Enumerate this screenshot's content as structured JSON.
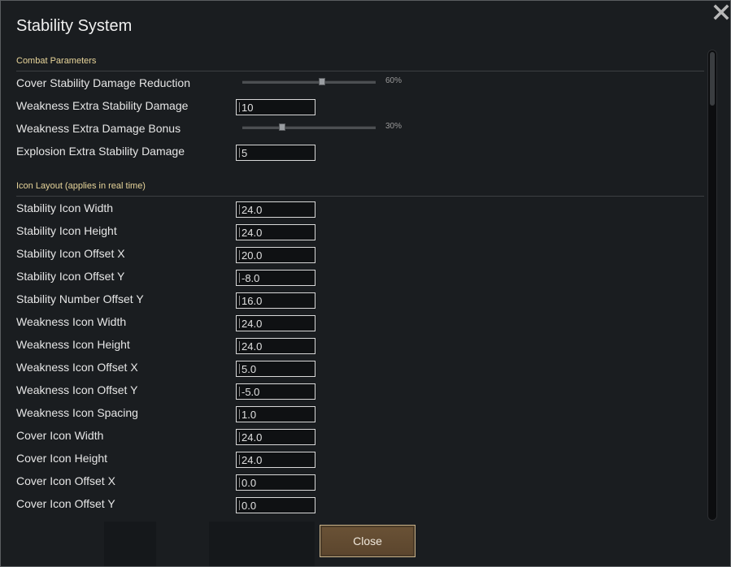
{
  "dialog": {
    "title": "Stability System",
    "close_icon": "close-x-icon"
  },
  "combat": {
    "header": "Combat Parameters",
    "cover_reduction": {
      "label": "Cover Stability Damage Reduction",
      "value_text": "60%",
      "value": 0.6
    },
    "weakness_stability": {
      "label": "Weakness Extra Stability Damage",
      "value": "10"
    },
    "weakness_bonus": {
      "label": "Weakness Extra Damage Bonus",
      "value_text": "30%",
      "value": 0.3
    },
    "explosion_stability": {
      "label": "Explosion Extra Stability Damage",
      "value": "5"
    }
  },
  "icon_layout": {
    "header": "Icon Layout (applies in real time)",
    "fields": [
      {
        "label": "Stability Icon Width",
        "value": "24.0"
      },
      {
        "label": "Stability Icon Height",
        "value": "24.0"
      },
      {
        "label": "Stability Icon Offset X",
        "value": "20.0"
      },
      {
        "label": "Stability Icon Offset Y",
        "value": "-8.0"
      },
      {
        "label": "Stability Number Offset Y",
        "value": "16.0"
      },
      {
        "label": "Weakness Icon Width",
        "value": "24.0"
      },
      {
        "label": "Weakness Icon Height",
        "value": "24.0"
      },
      {
        "label": "Weakness Icon Offset X",
        "value": "5.0"
      },
      {
        "label": "Weakness Icon Offset Y",
        "value": "-5.0"
      },
      {
        "label": "Weakness Icon Spacing",
        "value": "1.0"
      },
      {
        "label": "Cover Icon Width",
        "value": "24.0"
      },
      {
        "label": "Cover Icon Height",
        "value": "24.0"
      },
      {
        "label": "Cover Icon Offset X",
        "value": "0.0"
      },
      {
        "label": "Cover Icon Offset Y",
        "value": "0.0"
      }
    ]
  },
  "footer": {
    "close_label": "Close"
  },
  "colors": {
    "section_header": "#e8d59a",
    "button_bg": "#5b452d",
    "button_border": "#c9b38c"
  }
}
